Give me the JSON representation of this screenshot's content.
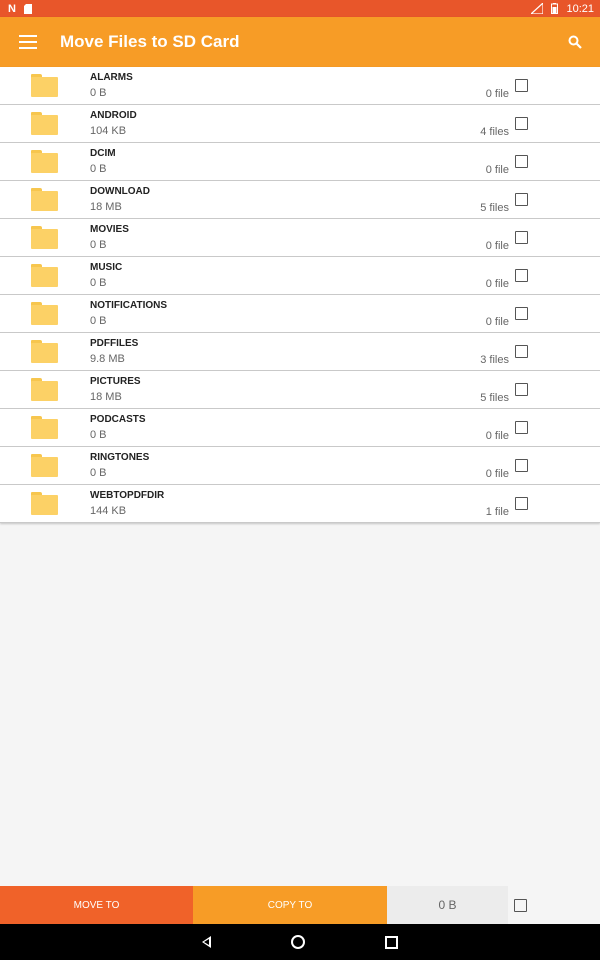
{
  "status": {
    "time": "10:21",
    "left_icons": [
      "n-icon",
      "sd-card-icon"
    ],
    "right_icons": [
      "signal-icon",
      "battery-icon"
    ]
  },
  "appbar": {
    "title": "Move Files to SD Card"
  },
  "folders": [
    {
      "name": "ALARMS",
      "size": "0 B",
      "count": "0 file"
    },
    {
      "name": "ANDROID",
      "size": "104 KB",
      "count": "4 files"
    },
    {
      "name": "DCIM",
      "size": "0 B",
      "count": "0 file"
    },
    {
      "name": "DOWNLOAD",
      "size": "18 MB",
      "count": "5 files"
    },
    {
      "name": "MOVIES",
      "size": "0 B",
      "count": "0 file"
    },
    {
      "name": "MUSIC",
      "size": "0 B",
      "count": "0 file"
    },
    {
      "name": "NOTIFICATIONS",
      "size": "0 B",
      "count": "0 file"
    },
    {
      "name": "PDFFILES",
      "size": "9.8 MB",
      "count": "3 files"
    },
    {
      "name": "PICTURES",
      "size": "18 MB",
      "count": "5 files"
    },
    {
      "name": "PODCASTS",
      "size": "0 B",
      "count": "0 file"
    },
    {
      "name": "RINGTONES",
      "size": "0 B",
      "count": "0 file"
    },
    {
      "name": "WEBTOPDFDIR",
      "size": "144 KB",
      "count": "1 file"
    }
  ],
  "bottom": {
    "move_label": "MOVE TO",
    "copy_label": "COPY TO",
    "total": "0 B"
  },
  "colors": {
    "status_bar": "#e8562a",
    "app_bar": "#f79c26",
    "move_button": "#f06229",
    "copy_button": "#f79c26",
    "folder": "#fcd166"
  }
}
